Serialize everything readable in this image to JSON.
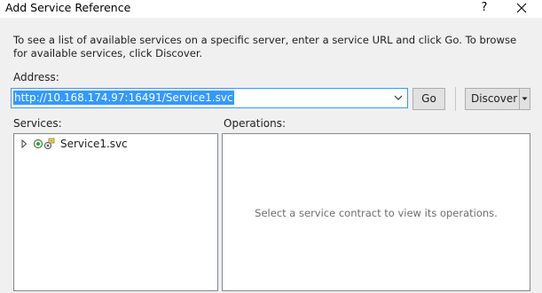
{
  "window": {
    "title": "Add Service Reference",
    "help_glyph": "?"
  },
  "intro_text": "To see a list of available services on a specific server, enter a service URL and click Go. To browse for available services, click Discover.",
  "address": {
    "label": "Address:",
    "value": "http://10.168.174.97:16491/Service1.svc"
  },
  "buttons": {
    "go": "Go",
    "discover": "Discover"
  },
  "services": {
    "label": "Services:",
    "items": [
      {
        "label": "Service1.svc",
        "icon": "service-icon",
        "expanded": false
      }
    ]
  },
  "operations": {
    "label": "Operations:",
    "placeholder": "Select a service contract to view its operations."
  },
  "colors": {
    "selection": "#3399ff",
    "window_bg": "#f0f0f0",
    "panel_border": "#828790"
  }
}
